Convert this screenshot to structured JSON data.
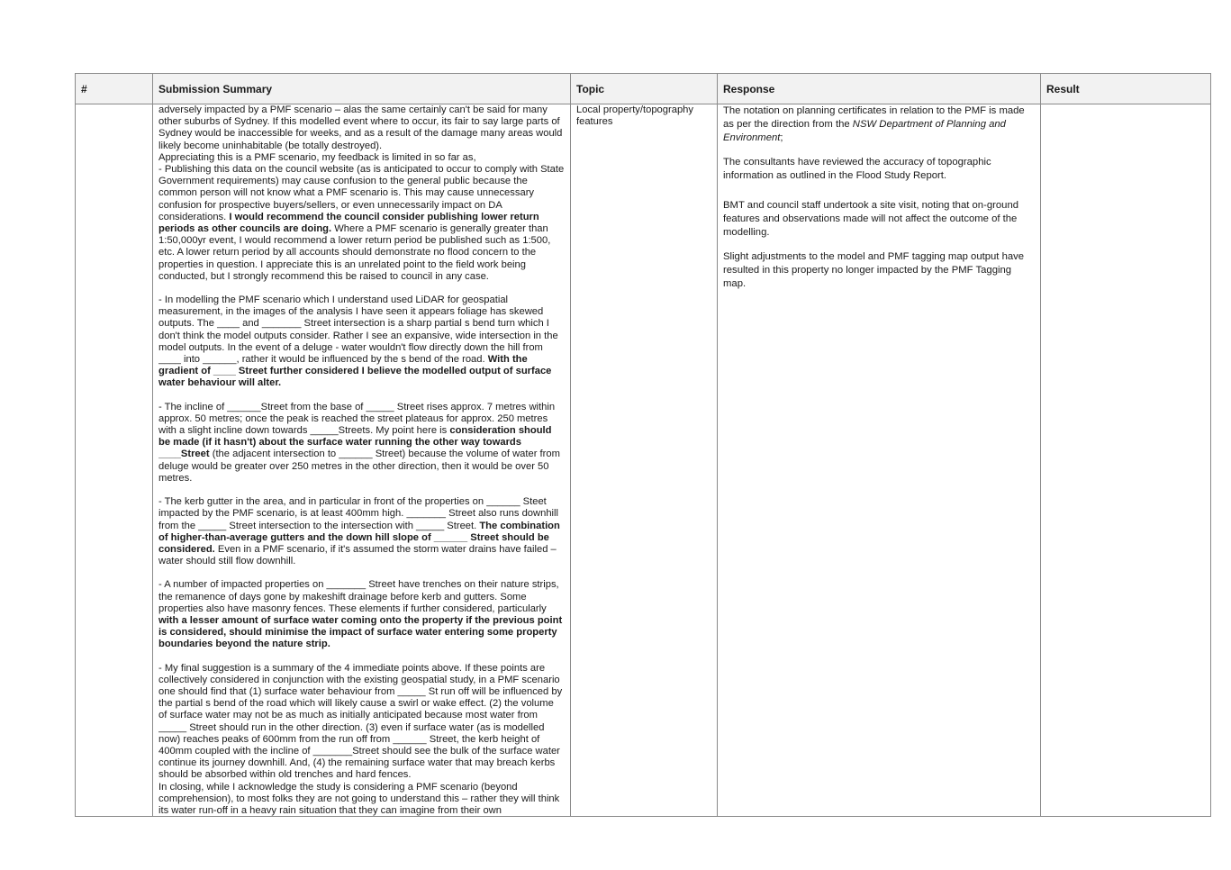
{
  "table": {
    "headers": {
      "num": "#",
      "summary": "Submission Summary",
      "topic": "Topic",
      "response": "Response",
      "result": "Result"
    },
    "row": {
      "num": "",
      "topic": "Local property/topography features",
      "result": "",
      "summary": {
        "p1": "adversely impacted by a PMF scenario – alas the same certainly can't be said for many other suburbs of Sydney. If this modelled event where to occur, its fair to say large parts of Sydney would be inaccessible for weeks, and as a result of the damage many areas would likely become uninhabitable (be totally destroyed).",
        "p2": "Appreciating this is a PMF scenario, my feedback is limited in so far as,",
        "p3a": "- Publishing this data on the council website (as is anticipated to occur to comply with State Government requirements) may cause confusion to the general public because the common person will not know what a PMF scenario is. This may cause unnecessary confusion for prospective buyers/sellers, or even unnecessarily impact on DA considerations. ",
        "p3b": "I would recommend the council consider publishing lower return periods as other councils are doing.",
        "p3c": " Where a PMF scenario is generally greater than 1:50,000yr event, I would recommend a lower return period be published such as 1:500, etc. A lower return period by all accounts should demonstrate no flood concern to the properties in question. I appreciate this is an unrelated point to the field work being conducted, but I strongly recommend this be raised to council in any case.",
        "p4a": "- In modelling the PMF scenario which I understand used LiDAR for geospatial measurement, in the images of the analysis I have seen it appears foliage has skewed outputs. The ____ and _______ Street intersection is a sharp partial s bend turn which I don't think the model outputs consider. Rather I see an expansive, wide intersection in the model outputs. In the event of a deluge - water wouldn't flow directly down the hill from ____ into ______, rather it would be influenced by the s bend of the road. ",
        "p4b": "With the gradient of ____ Street further considered I believe the modelled output of surface water behaviour will alter.",
        "p5a": "- The incline of ______Street from the base of _____ Street rises approx. 7 metres within approx. 50 metres; once the peak is reached the street plateaus for approx. 250 metres with a slight incline down towards _____Streets. My point here is ",
        "p5b": "consideration should be made (if it hasn't) about the surface water running the other way towards ____Street",
        "p5c": " (the adjacent intersection to ______ Street) because the volume of water from deluge would be greater over 250 metres in the other direction, then it would be over 50 metres.",
        "p6a": "- The kerb gutter in the area, and in particular in front of the properties on ______ Steet impacted by the PMF scenario, is at least 400mm high. _______ Street also runs downhill from the _____ Street intersection to the intersection with _____ Street. ",
        "p6b": "The combination of higher-than-average gutters and the down hill slope of ______ Street should be considered.",
        "p6c": " Even in a PMF scenario, if it's assumed the storm water drains have failed – water should still flow downhill.",
        "p7a": "- A number of impacted properties on _______ Street have trenches on their nature strips, the remanence of days gone by makeshift drainage before kerb and gutters. Some properties also have masonry fences. These elements if further considered, particularly ",
        "p7b": "with a lesser amount of surface water coming onto the property if the previous point is considered, should minimise the impact of surface water entering some property boundaries beyond the nature strip.",
        "p8": "- My final suggestion is a summary of the 4 immediate points above. If these points are collectively considered in conjunction with the existing geospatial study, in a PMF scenario one should find that (1) surface water behaviour from _____ St run off will be influenced by the partial s bend of the road which will likely cause a swirl or wake effect. (2) the volume of surface water may not be as much as initially anticipated because most water from _____ Street should run in the other direction. (3) even if surface water (as is modelled now) reaches peaks of 600mm from the run off from ______ Street, the kerb height of 400mm coupled with the incline of _______Street should see the bulk of the surface water continue its journey downhill. And, (4) the remaining surface water that may breach kerbs should be absorbed within old trenches and hard fences.",
        "p9": "In closing, while I acknowledge the study is considering a PMF scenario (beyond comprehension), to most folks they are not going to understand this – rather they will think its water run-off in a heavy rain situation that they can imagine from their own"
      },
      "response": {
        "r1a": "The notation on planning certificates in relation to the PMF is made as per the direction from the ",
        "r1b": "NSW Department of Planning and Environment",
        "r1c": ";",
        "r2": "The consultants have reviewed the accuracy of topographic information as outlined in the Flood Study Report.",
        "r3": "BMT and council staff undertook a site visit, noting that on-ground features and observations made will not affect the outcome of the modelling.",
        "r4": "Slight adjustments to the model and PMF tagging map output have resulted in this property no longer impacted by the PMF Tagging map."
      }
    }
  }
}
